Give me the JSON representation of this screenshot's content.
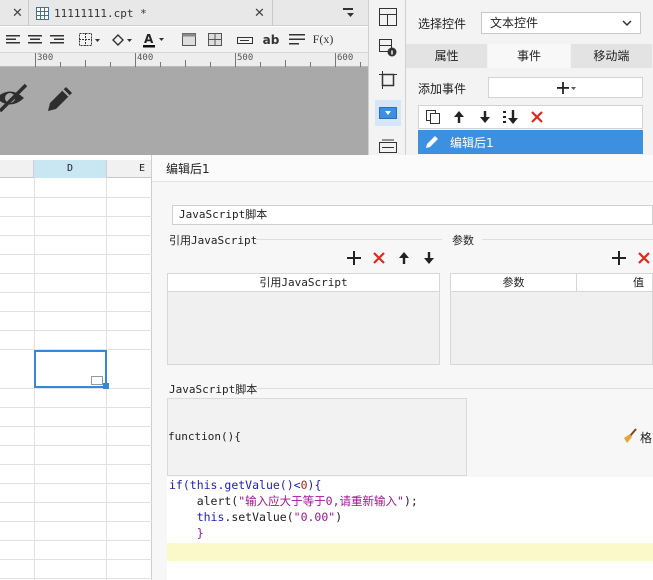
{
  "tabs": {
    "left_close": "✕",
    "file_tab": "11111111.cpt *",
    "file_close": "✕"
  },
  "toolbar": {
    "text_tool": "ab",
    "formula_tool": "F(x)"
  },
  "ruler": [
    "300",
    "400",
    "500",
    "600"
  ],
  "right_panel": {
    "select_label": "选择控件",
    "select_value": "文本控件",
    "tabs": [
      "属性",
      "事件",
      "移动端"
    ],
    "active_tab": "事件",
    "add_event_label": "添加事件",
    "event_item": "编辑后1"
  },
  "sheet": {
    "columns": [
      "D",
      "E"
    ]
  },
  "dialog": {
    "title": "编辑后1",
    "script_type": "JavaScript脚本",
    "ref_section": "引用JavaScript",
    "param_section": "参数",
    "ref_table_header": "引用JavaScript",
    "param_table_headers": [
      "参数",
      "值"
    ],
    "script_section": "JavaScript脚本",
    "function_header": "function(){",
    "format_label": "格",
    "code_lines": [
      {
        "parts": [
          {
            "t": "if(",
            "c": "kw"
          },
          {
            "t": "this",
            "c": "kw"
          },
          {
            "t": ".getValue()<",
            "c": "kw"
          },
          {
            "t": "0",
            "c": "num"
          },
          {
            "t": "){",
            "c": "kw"
          }
        ]
      },
      {
        "parts": [
          {
            "t": "    alert(",
            "c": ""
          },
          {
            "t": "\"输入应大于等于0,请重新输入\"",
            "c": "str"
          },
          {
            "t": ");",
            "c": ""
          }
        ]
      },
      {
        "parts": [
          {
            "t": "    ",
            "c": ""
          },
          {
            "t": "this",
            "c": "kw"
          },
          {
            "t": ".setValue(",
            "c": ""
          },
          {
            "t": "\"0.00\"",
            "c": "str"
          },
          {
            "t": ")",
            "c": ""
          }
        ]
      },
      {
        "parts": [
          {
            "t": "    }",
            "c": "brace"
          }
        ]
      }
    ]
  },
  "colors": {
    "accent": "#3d8fe0",
    "delete": "#e0281e",
    "canvas": "#a9a9a9",
    "selected_col": "#c9e6f3"
  }
}
